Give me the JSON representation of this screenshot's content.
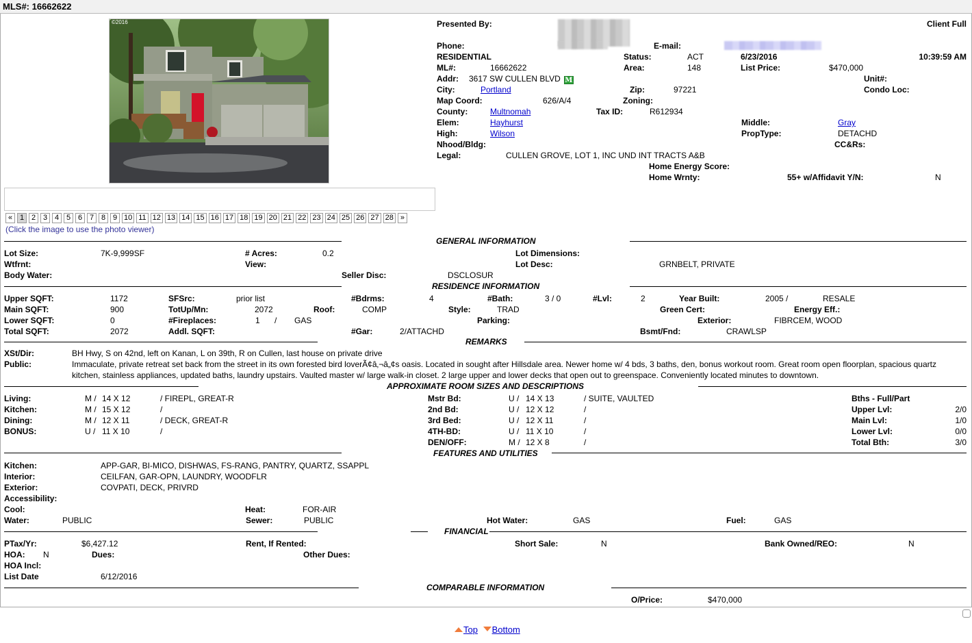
{
  "header": {
    "mls_title": "MLS#: 16662622"
  },
  "photo": {
    "watermark": "©2016",
    "hint": "(Click the image to use the photo viewer)",
    "pager": {
      "prev": "«",
      "next": "»",
      "pages": [
        "1",
        "2",
        "3",
        "4",
        "5",
        "6",
        "7",
        "8",
        "9",
        "10",
        "11",
        "12",
        "13",
        "14",
        "15",
        "16",
        "17",
        "18",
        "19",
        "20",
        "21",
        "22",
        "23",
        "24",
        "25",
        "26",
        "27",
        "28"
      ],
      "current": "1"
    }
  },
  "summary": {
    "presented_by_label": "Presented By:",
    "report_type": "Client Full",
    "phone_label": "Phone:",
    "email_label": "E-mail:",
    "property_class": "RESIDENTIAL",
    "status_label": "Status:",
    "status": "ACT",
    "date": "6/23/2016",
    "time": "10:39:59 AM",
    "ml_label": "ML#:",
    "ml": "16662622",
    "area_label": "Area:",
    "area": "148",
    "list_price_label": "List Price:",
    "list_price": "$470,000",
    "addr_label": "Addr:",
    "addr": "3617 SW CULLEN BLVD",
    "map_badge": "M",
    "unit_label": "Unit#:",
    "city_label": "City:",
    "city": "Portland",
    "zip_label": "Zip:",
    "zip": "97221",
    "condo_loc_label": "Condo Loc:",
    "map_coord_label": "Map Coord:",
    "map_coord": "626/A/4",
    "zoning_label": "Zoning:",
    "county_label": "County:",
    "county": "Multnomah",
    "tax_id_label": "Tax ID:",
    "tax_id": "R612934",
    "elem_label": "Elem:",
    "elem": "Hayhurst",
    "middle_label": "Middle:",
    "middle": "Gray",
    "high_label": "High:",
    "high": "Wilson",
    "prop_type_label": "PropType:",
    "prop_type": "DETACHD",
    "nhood_label": "Nhood/Bldg:",
    "ccrs_label": "CC&Rs:",
    "legal_label": "Legal:",
    "legal": "CULLEN GROVE, LOT 1, INC UND INT TRACTS A&B",
    "energy_score_label": "Home Energy Score:",
    "home_wrnty_label": "Home Wrnty:",
    "affidavit_label": "55+ w/Affidavit Y/N:",
    "affidavit": "N"
  },
  "general": {
    "title": "GENERAL INFORMATION",
    "lot_size_label": "Lot Size:",
    "lot_size": "7K-9,999SF",
    "acres_label": "# Acres:",
    "acres": "0.2",
    "lot_dim_label": "Lot Dimensions:",
    "wtfrnt_label": "Wtfrnt:",
    "view_label": "View:",
    "lot_desc_label": "Lot Desc:",
    "lot_desc": "GRNBELT, PRIVATE",
    "body_water_label": "Body Water:",
    "seller_disc_label": "Seller Disc:",
    "seller_disc": "DSCLOSUR"
  },
  "residence": {
    "title": "RESIDENCE INFORMATION",
    "upper_sqft_label": "Upper SQFT:",
    "upper_sqft": "1172",
    "sfsrc_label": "SFSrc:",
    "sfsrc": "prior list",
    "bdrms_label": "#Bdrms:",
    "bdrms": "4",
    "bath_label": "#Bath:",
    "bath": "3 / 0",
    "lvl_label": "#Lvl:",
    "lvl": "2",
    "year_built_label": "Year Built:",
    "year_built": "2005 /",
    "year_built_type": "RESALE",
    "main_sqft_label": "Main SQFT:",
    "main_sqft": "900",
    "totupmn_label": "TotUp/Mn:",
    "totupmn": "2072",
    "roof_label": "Roof:",
    "roof": "COMP",
    "style_label": "Style:",
    "style": "TRAD",
    "green_cert_label": "Green Cert:",
    "energy_eff_label": "Energy Eff.:",
    "lower_sqft_label": "Lower SQFT:",
    "lower_sqft": "0",
    "fireplaces_label": "#Fireplaces:",
    "fireplaces": "1",
    "fireplace_sep": "/",
    "fireplace_type": "GAS",
    "parking_label": "Parking:",
    "exterior_label": "Exterior:",
    "exterior": "FIBRCEM, WOOD",
    "total_sqft_label": "Total SQFT:",
    "total_sqft": "2072",
    "addl_sqft_label": "Addl. SQFT:",
    "gar_label": "#Gar:",
    "gar": "2/ATTACHD",
    "bsmt_label": "Bsmt/Fnd:",
    "bsmt": "CRAWLSP"
  },
  "remarks": {
    "title": "REMARKS",
    "xst_label": "XSt/Dir:",
    "xst": "BH Hwy, S on 42nd, left on Kanan, L on 39th, R on Cullen, last house on private drive",
    "public_label": "Public:",
    "public_line1": "Immaculate, private retreat set back from the street in its own forested bird loverÃ¢â‚¬â„¢s oasis. Located in sought after Hillsdale area. Newer home w/ 4 bds, 3 baths, den, bonus workout room. Great room open floorplan, spacious quartz",
    "public_line2": "kitchen, stainless appliances, updated baths, laundry upstairs. Vaulted master w/ large walk-in closet. 2 large upper and lower decks that open out to greenspace. Conveniently located minutes to downtown."
  },
  "rooms": {
    "title": "APPROXIMATE ROOM SIZES AND DESCRIPTIONS",
    "left": [
      {
        "name": "Living:",
        "lvl": "M /",
        "size": "14 X 12",
        "desc": "/  FIREPL, GREAT-R"
      },
      {
        "name": "Kitchen:",
        "lvl": "M /",
        "size": "15 X 12",
        "desc": "/"
      },
      {
        "name": "Dining:",
        "lvl": "M /",
        "size": "12 X 11",
        "desc": "/  DECK, GREAT-R"
      },
      {
        "name": "BONUS:",
        "lvl": "U /",
        "size": "11 X 10",
        "desc": "/"
      }
    ],
    "right": [
      {
        "name": "Mstr Bd:",
        "lvl": "U /",
        "size": "14 X 13",
        "desc": "/  SUITE, VAULTED"
      },
      {
        "name": "2nd Bd:",
        "lvl": "U /",
        "size": "12 X 12",
        "desc": "/"
      },
      {
        "name": "3rd Bed:",
        "lvl": "U /",
        "size": "12 X 11",
        "desc": "/"
      },
      {
        "name": "4TH-BD:",
        "lvl": "U /",
        "size": "11 X 10",
        "desc": "/"
      },
      {
        "name": "DEN/OFF:",
        "lvl": "M /",
        "size": "12 X 8",
        "desc": "/"
      }
    ],
    "baths_title": "Bths - Full/Part",
    "baths": [
      {
        "label": "Upper Lvl:",
        "value": "2/0"
      },
      {
        "label": "Main Lvl:",
        "value": "1/0"
      },
      {
        "label": "Lower Lvl:",
        "value": "0/0"
      },
      {
        "label": "Total Bth:",
        "value": "3/0"
      }
    ]
  },
  "features": {
    "title": "FEATURES AND UTILITIES",
    "kitchen_label": "Kitchen:",
    "kitchen": "APP-GAR, BI-MICO, DISHWAS, FS-RANG, PANTRY, QUARTZ, SSAPPL",
    "interior_label": "Interior:",
    "interior": "CEILFAN, GAR-OPN, LAUNDRY, WOODFLR",
    "exterior_label": "Exterior:",
    "exterior": "COVPATI, DECK, PRIVRD",
    "accessibility_label": "Accessibility:",
    "cool_label": "Cool:",
    "heat_label": "Heat:",
    "heat": "FOR-AIR",
    "water_label": "Water:",
    "water": "PUBLIC",
    "sewer_label": "Sewer:",
    "sewer": "PUBLIC",
    "hot_water_label": "Hot Water:",
    "hot_water": "GAS",
    "fuel_label": "Fuel:",
    "fuel": "GAS"
  },
  "financial": {
    "title": "FINANCIAL",
    "ptax_label": "PTax/Yr:",
    "ptax": "$6,427.12",
    "rent_label": "Rent, If Rented:",
    "short_sale_label": "Short Sale:",
    "short_sale": "N",
    "bank_owned_label": "Bank Owned/REO:",
    "bank_owned": "N",
    "hoa_label": "HOA:",
    "hoa": "N",
    "dues_label": "Dues:",
    "other_dues_label": "Other Dues:",
    "hoa_incl_label": "HOA Incl:",
    "list_date_label": "List Date",
    "list_date": "6/12/2016"
  },
  "comparable": {
    "title": "COMPARABLE INFORMATION",
    "oprice_label": "O/Price:",
    "oprice": "$470,000"
  },
  "footer": {
    "top": "Top",
    "bottom": "Bottom"
  },
  "colors": {
    "link": "#0000cc",
    "hint": "#333399",
    "badge": "#2ea33a",
    "arrow": "#f07c3c"
  }
}
